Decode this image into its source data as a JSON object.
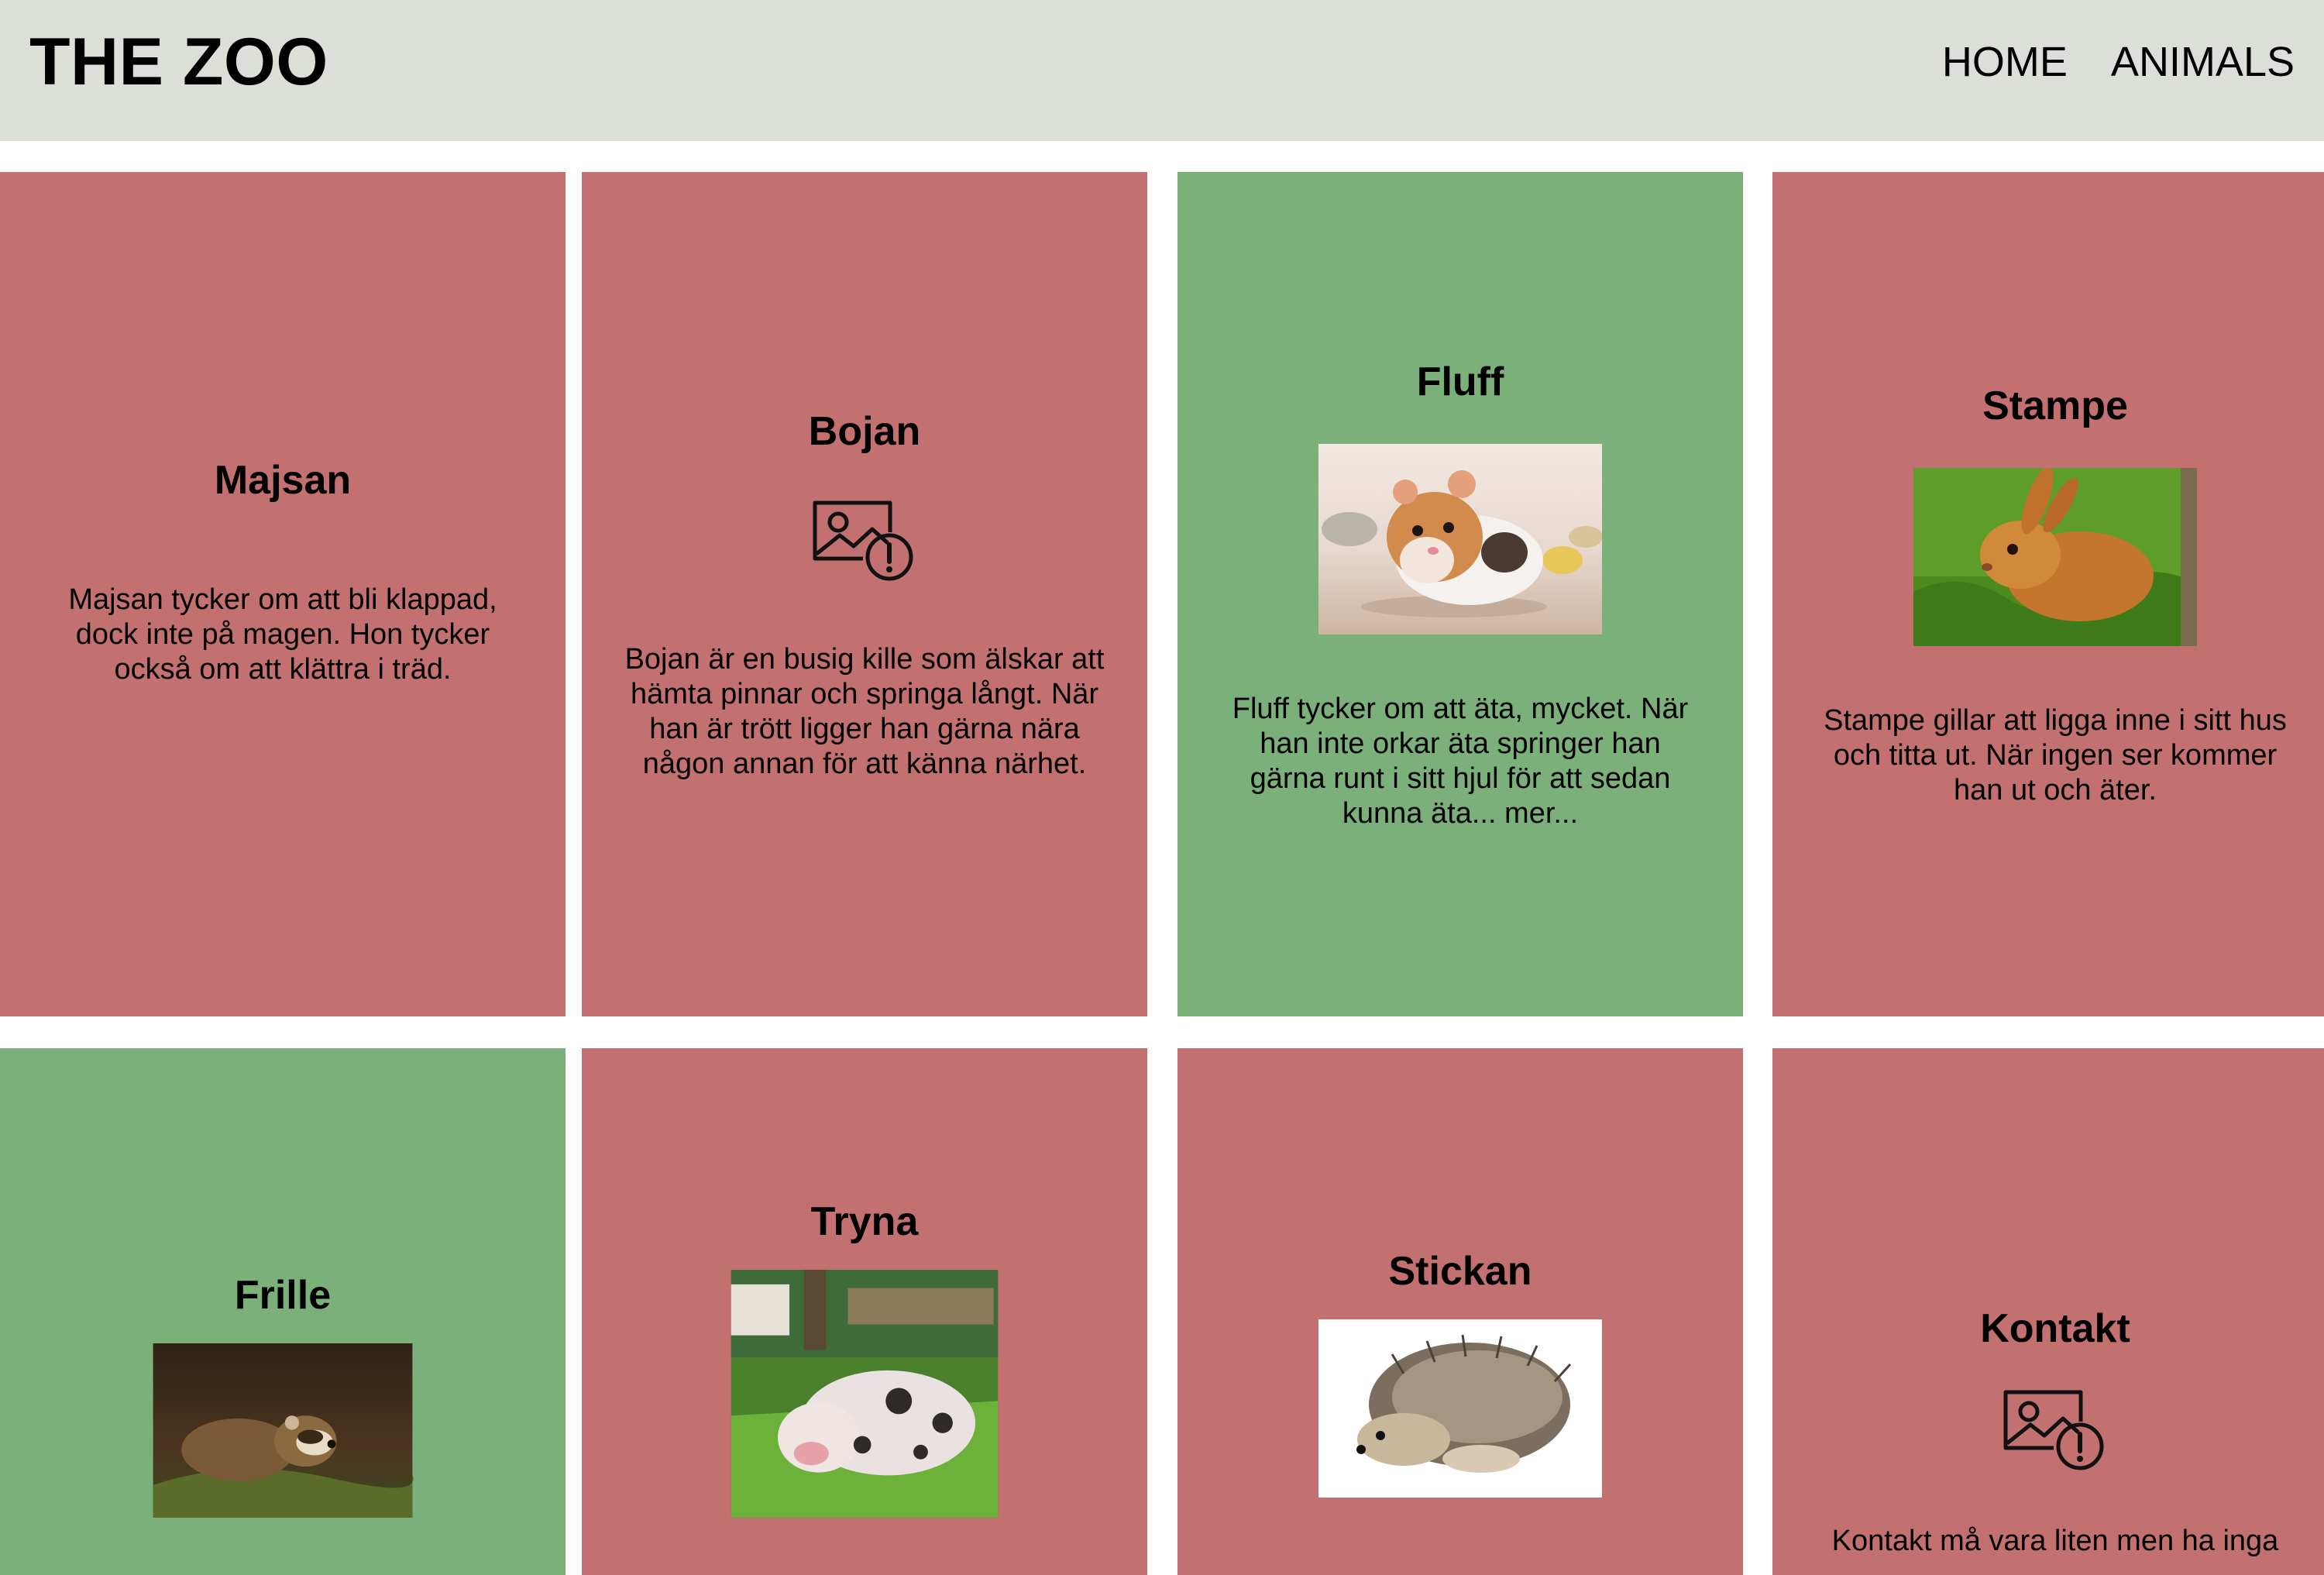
{
  "header": {
    "logo": "THE ZOO",
    "nav": [
      {
        "label": "HOME"
      },
      {
        "label": "ANIMALS"
      }
    ]
  },
  "colors": {
    "header_bg": "#dcded8",
    "card_red": "#c37070",
    "card_green": "#7bb07b"
  },
  "cards": [
    {
      "name": "Majsan",
      "text": "Majsan tycker om att bli klappad, dock inte på magen. Hon tycker också om att klättra i träd.",
      "color": "red",
      "image": "none"
    },
    {
      "name": "Bojan",
      "text": "Bojan är en busig kille som älskar att hämta pinnar och springa långt. När han är trött ligger han gärna nära någon annan för att känna närhet.",
      "color": "red",
      "image": "broken-image-icon"
    },
    {
      "name": "Fluff",
      "text": "Fluff tycker om att äta, mycket. När han inte orkar äta springer han gärna runt i sitt hjul för att sedan kunna äta... mer...",
      "color": "green",
      "image": "hamster-photo"
    },
    {
      "name": "Stampe",
      "text": "Stampe gillar att ligga inne i sitt hus och titta ut. När ingen ser kommer han ut och äter.",
      "color": "red",
      "image": "rabbit-photo"
    },
    {
      "name": "Frille",
      "text": "",
      "color": "green",
      "image": "ferret-photo"
    },
    {
      "name": "Tryna",
      "text": "",
      "color": "red",
      "image": "pig-photo"
    },
    {
      "name": "Stickan",
      "text": "",
      "color": "red",
      "image": "hedgehog-photo"
    },
    {
      "name": "Kontakt",
      "text": "Kontakt må vara liten men ha inga",
      "color": "red",
      "image": "broken-image-icon"
    }
  ]
}
